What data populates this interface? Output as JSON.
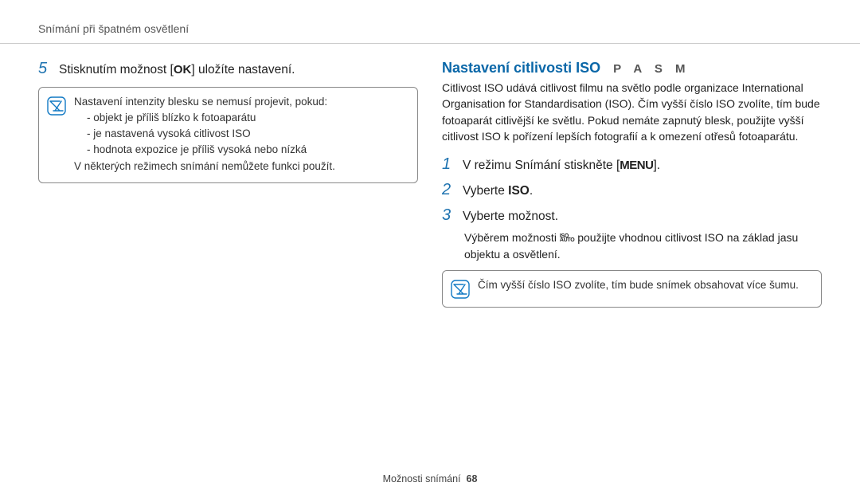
{
  "header": {
    "title": "Snímání při špatném osvětlení"
  },
  "left": {
    "step5_num": "5",
    "step5_before": "Stisknutím možnost [",
    "step5_icon": "OK",
    "step5_after": "] uložíte nastavení.",
    "note": {
      "line1": "Nastavení intenzity blesku se nemusí projevit, pokud:",
      "bullets": [
        "objekt je příliš blízko k fotoaparátu",
        "je nastavená vysoká citlivost ISO",
        "hodnota expozice je příliš vysoká nebo nízká"
      ],
      "line2": "V některých režimech snímání nemůžete funkci použít."
    }
  },
  "right": {
    "title": "Nastavení citlivosti ISO",
    "modes": "P A S M",
    "intro": "Citlivost ISO udává citlivost filmu na světlo podle organizace International Organisation for Standardisation (ISO). Čím vyšší číslo ISO zvolíte, tím bude fotoaparát citlivější ke světlu. Pokud nemáte zapnutý blesk, použijte vyšší citlivost ISO k pořízení lepších fotografií a k omezení otřesů fotoaparátu.",
    "steps": {
      "s1_num": "1",
      "s1_before": "V režimu Snímání stiskněte [",
      "s1_icon": "MENU",
      "s1_after": "].",
      "s2_num": "2",
      "s2_before": "Vyberte ",
      "s2_bold": "ISO",
      "s2_after": ".",
      "s3_num": "3",
      "s3_text": "Vyberte možnost.",
      "s3_sub_before": "Výběrem možnosti ",
      "s3_sub_icon_top": "ISO",
      "s3_sub_icon_bot": "AUTO",
      "s3_sub_after": " použijte vhodnou citlivost ISO na základ jasu objektu a osvětlení."
    },
    "note2": "Čím vyšší číslo ISO zvolíte, tím bude snímek obsahovat více šumu."
  },
  "footer": {
    "section": "Možnosti snímání",
    "page": "68"
  }
}
